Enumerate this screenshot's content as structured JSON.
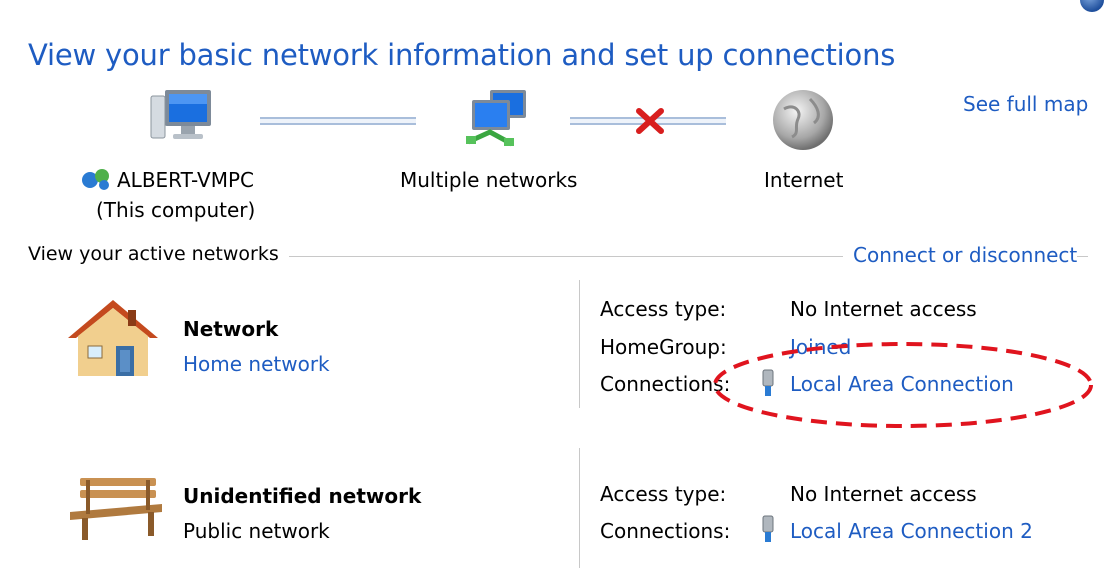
{
  "page_title": "View your basic network information and set up connections",
  "see_full_map": "See full map",
  "network_map": {
    "computer_name": "ALBERT-VMPC",
    "computer_sub": "(This computer)",
    "middle_node": "Multiple networks",
    "internet_node": "Internet"
  },
  "active_networks": {
    "header": "View your active networks",
    "connect_link": "Connect or disconnect",
    "networks": [
      {
        "name": "Network",
        "type": "Home network",
        "access_type_label": "Access type:",
        "access_type_value": "No Internet access",
        "homegroup_label": "HomeGroup:",
        "homegroup_value": "Joined",
        "connections_label": "Connections:",
        "connections_value": "Local Area Connection"
      },
      {
        "name": "Unidentified network",
        "type": "Public network",
        "access_type_label": "Access type:",
        "access_type_value": "No Internet access",
        "connections_label": "Connections:",
        "connections_value": "Local Area Connection 2"
      }
    ]
  },
  "colors": {
    "link": "#1e5cc2",
    "annotation": "#e0141e"
  },
  "icons": [
    "help-icon",
    "computer-icon",
    "multiple-networks-icon",
    "disconnected-x-icon",
    "globe-icon",
    "network-share-icon",
    "house-icon",
    "bench-icon",
    "ethernet-plug-icon"
  ]
}
